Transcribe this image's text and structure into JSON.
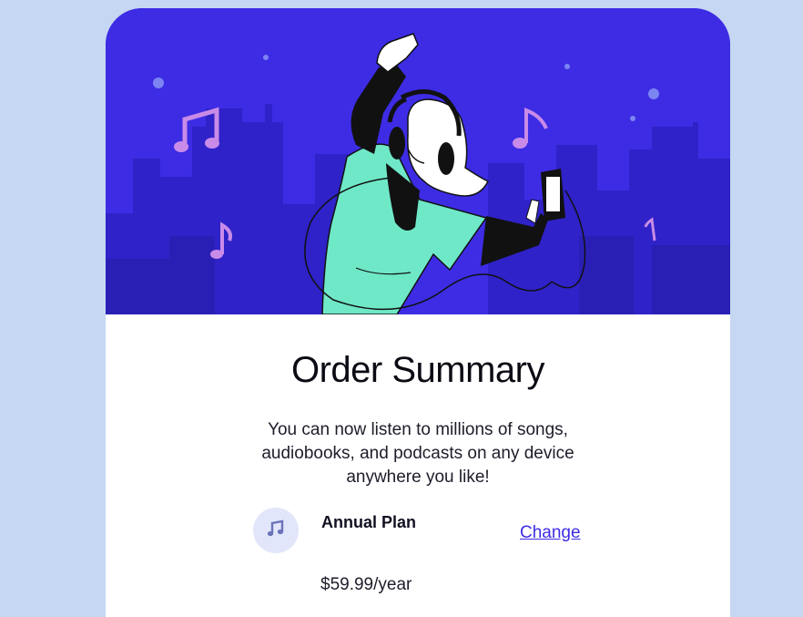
{
  "order": {
    "title": "Order Summary",
    "description": "You can now listen to millions of songs, audiobooks, and podcasts on any device anywhere you like!"
  },
  "plan": {
    "icon": "music-note-icon",
    "name": "Annual Plan",
    "price": "$59.99/year",
    "change_label": "Change"
  },
  "colors": {
    "page_background": "#c5d7f2",
    "hero_background": "#3d2ce4",
    "accent": "#3d2ce4",
    "icon_circle": "#e1e6fb"
  }
}
